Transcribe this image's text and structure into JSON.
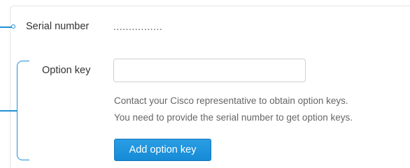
{
  "serial": {
    "label": "Serial number",
    "value": "................"
  },
  "option_key": {
    "label": "Option key",
    "value": "",
    "placeholder": ""
  },
  "help": {
    "line1": "Contact your Cisco representative to obtain option keys.",
    "line2": "You need to provide the serial number to get option keys."
  },
  "actions": {
    "add_label": "Add option key"
  },
  "colors": {
    "accent": "#1f8fd6",
    "button": "#1a8fd8"
  }
}
